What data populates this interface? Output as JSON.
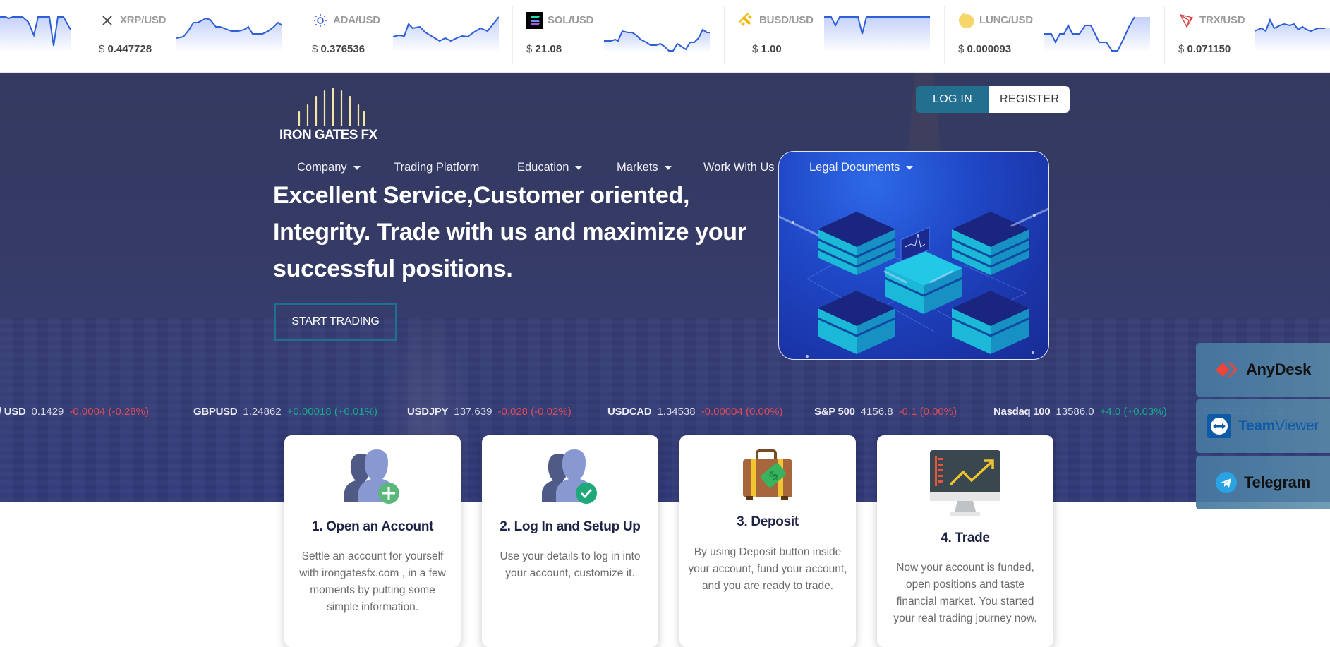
{
  "crypto_ticker": [
    {
      "pair": "",
      "price": "",
      "icon": "partial-coin"
    },
    {
      "pair": "XRP/USD",
      "price": "0.447728",
      "currency": "$",
      "icon": "xrp-icon"
    },
    {
      "pair": "ADA/USD",
      "price": "0.376536",
      "currency": "$",
      "icon": "ada-icon"
    },
    {
      "pair": "SOL/USD",
      "price": "21.08",
      "currency": "$",
      "icon": "sol-icon"
    },
    {
      "pair": "BUSD/USD",
      "price": "1.00",
      "currency": "$",
      "icon": "busd-icon"
    },
    {
      "pair": "LUNC/USD",
      "price": "0.000093",
      "currency": "$",
      "icon": "lunc-icon"
    },
    {
      "pair": "TRX/USD",
      "price": "0.071150",
      "currency": "$",
      "icon": "trx-icon"
    }
  ],
  "brand": {
    "name": "IRON GATES FX",
    "accent": "#f3e7a6"
  },
  "auth": {
    "login": "LOG IN",
    "register": "REGISTER"
  },
  "nav": [
    {
      "label": "Company",
      "dropdown": true
    },
    {
      "label": "Trading Platform",
      "dropdown": false
    },
    {
      "label": "Education",
      "dropdown": true
    },
    {
      "label": "Markets",
      "dropdown": true
    },
    {
      "label": "Work With Us",
      "dropdown": false
    },
    {
      "label": "Legal Documents",
      "dropdown": true
    }
  ],
  "hero": {
    "headline_lines": [
      "Excellent Service,Customer oriented,",
      "Integrity. Trade with us and maximize your",
      "successful positions."
    ],
    "cta": "START TRADING"
  },
  "fx_ticker": [
    {
      "symbol": "/ USD",
      "value": "0.1429",
      "change": "-0.0004 (-0.28%)",
      "direction": "down"
    },
    {
      "symbol": "GBPUSD",
      "value": "1.24862",
      "change": "+0.00018 (+0.01%)",
      "direction": "up"
    },
    {
      "symbol": "USDJPY",
      "value": "137.639",
      "change": "-0.028 (-0.02%)",
      "direction": "down"
    },
    {
      "symbol": "USDCAD",
      "value": "1.34538",
      "change": "-0.00004 (0.00%)",
      "direction": "down"
    },
    {
      "symbol": "S&P 500",
      "value": "4156.8",
      "change": "-0.1 (0.00%)",
      "direction": "down"
    },
    {
      "symbol": "Nasdaq 100",
      "value": "13586.0",
      "change": "+4.0 (+0.03%)",
      "direction": "up"
    },
    {
      "symbol": "EUR/USD",
      "value": "1.08380",
      "change": "",
      "direction": "up"
    }
  ],
  "support": [
    {
      "label": "AnyDesk",
      "icon": "anydesk-icon"
    },
    {
      "label_bold": "Team",
      "label_rest": "Viewer",
      "icon": "teamviewer-icon"
    },
    {
      "label": "Telegram",
      "icon": "telegram-icon"
    }
  ],
  "steps": [
    {
      "title": "1. Open an Account",
      "desc": "Settle an account for yourself with irongatesfx.com , in a few moments by putting some simple information.",
      "icon": "add-user-icon"
    },
    {
      "title": "2. Log In and Setup Up",
      "desc": "Use your details to log in into your account, customize it.",
      "icon": "verified-user-icon"
    },
    {
      "title": "3. Deposit",
      "desc": "By using Deposit button inside your account, fund your account, and you are ready to trade.",
      "icon": "money-suitcase-icon"
    },
    {
      "title": "4. Trade",
      "desc": "Now your account is funded, open positions and taste financial market. You started your real trading journey now.",
      "icon": "trading-monitor-icon"
    }
  ],
  "colors": {
    "hero_bg": "#343a63",
    "login_bg": "#236f8f",
    "up": "#19a98a",
    "down": "#e04a55",
    "spark": "#2f5fd6"
  }
}
